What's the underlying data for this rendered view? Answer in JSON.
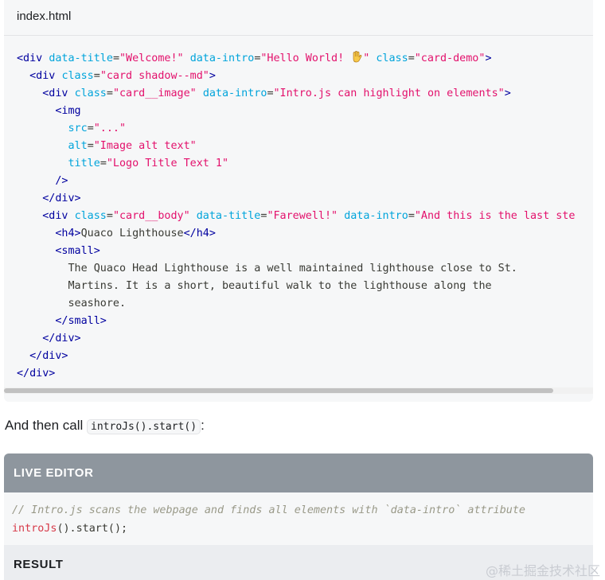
{
  "code_block": {
    "filename": "index.html",
    "lines": [
      [
        {
          "t": "<div ",
          "c": "tag"
        },
        {
          "t": "data-title",
          "c": "attr"
        },
        {
          "t": "=",
          "c": "punc"
        },
        {
          "t": "\"Welcome!\"",
          "c": "str"
        },
        {
          "t": " ",
          "c": "punc"
        },
        {
          "t": "data-intro",
          "c": "attr"
        },
        {
          "t": "=",
          "c": "punc"
        },
        {
          "t": "\"Hello World! ",
          "c": "str"
        },
        {
          "t": "WAVE",
          "c": "emoji"
        },
        {
          "t": "\"",
          "c": "str"
        },
        {
          "t": " ",
          "c": "punc"
        },
        {
          "t": "class",
          "c": "attr"
        },
        {
          "t": "=",
          "c": "punc"
        },
        {
          "t": "\"card-demo\"",
          "c": "str"
        },
        {
          "t": ">",
          "c": "tag"
        }
      ],
      [
        {
          "t": "  <div ",
          "c": "tag"
        },
        {
          "t": "class",
          "c": "attr"
        },
        {
          "t": "=",
          "c": "punc"
        },
        {
          "t": "\"card shadow--md\"",
          "c": "str"
        },
        {
          "t": ">",
          "c": "tag"
        }
      ],
      [
        {
          "t": "    <div ",
          "c": "tag"
        },
        {
          "t": "class",
          "c": "attr"
        },
        {
          "t": "=",
          "c": "punc"
        },
        {
          "t": "\"card__image\"",
          "c": "str"
        },
        {
          "t": " ",
          "c": "punc"
        },
        {
          "t": "data-intro",
          "c": "attr"
        },
        {
          "t": "=",
          "c": "punc"
        },
        {
          "t": "\"Intro.js can highlight on elements\"",
          "c": "str"
        },
        {
          "t": ">",
          "c": "tag"
        }
      ],
      [
        {
          "t": "      <img",
          "c": "tag"
        }
      ],
      [
        {
          "t": "        ",
          "c": "punc"
        },
        {
          "t": "src",
          "c": "attr"
        },
        {
          "t": "=",
          "c": "punc"
        },
        {
          "t": "\"...\"",
          "c": "str"
        }
      ],
      [
        {
          "t": "        ",
          "c": "punc"
        },
        {
          "t": "alt",
          "c": "attr"
        },
        {
          "t": "=",
          "c": "punc"
        },
        {
          "t": "\"Image alt text\"",
          "c": "str"
        }
      ],
      [
        {
          "t": "        ",
          "c": "punc"
        },
        {
          "t": "title",
          "c": "attr"
        },
        {
          "t": "=",
          "c": "punc"
        },
        {
          "t": "\"Logo Title Text 1\"",
          "c": "str"
        }
      ],
      [
        {
          "t": "      />",
          "c": "tag"
        }
      ],
      [
        {
          "t": "    </div>",
          "c": "tag"
        }
      ],
      [
        {
          "t": "    <div ",
          "c": "tag"
        },
        {
          "t": "class",
          "c": "attr"
        },
        {
          "t": "=",
          "c": "punc"
        },
        {
          "t": "\"card__body\"",
          "c": "str"
        },
        {
          "t": " ",
          "c": "punc"
        },
        {
          "t": "data-title",
          "c": "attr"
        },
        {
          "t": "=",
          "c": "punc"
        },
        {
          "t": "\"Farewell!\"",
          "c": "str"
        },
        {
          "t": " ",
          "c": "punc"
        },
        {
          "t": "data-intro",
          "c": "attr"
        },
        {
          "t": "=",
          "c": "punc"
        },
        {
          "t": "\"And this is the last ste",
          "c": "str"
        }
      ],
      [
        {
          "t": "      <h4>",
          "c": "tag"
        },
        {
          "t": "Quaco Lighthouse",
          "c": "punc"
        },
        {
          "t": "</h4>",
          "c": "tag"
        }
      ],
      [
        {
          "t": "      <small>",
          "c": "tag"
        }
      ],
      [
        {
          "t": "        The Quaco Head Lighthouse is a well maintained lighthouse close to St.",
          "c": "punc"
        }
      ],
      [
        {
          "t": "        Martins. It is a short, beautiful walk to the lighthouse along the",
          "c": "punc"
        }
      ],
      [
        {
          "t": "        seashore.",
          "c": "punc"
        }
      ],
      [
        {
          "t": "      </small>",
          "c": "tag"
        }
      ],
      [
        {
          "t": "    </div>",
          "c": "tag"
        }
      ],
      [
        {
          "t": "  </div>",
          "c": "tag"
        }
      ],
      [
        {
          "t": "</div>",
          "c": "tag"
        }
      ]
    ]
  },
  "prose": {
    "before": "And then call ",
    "inline_code": "introJs().start()",
    "after": ":"
  },
  "live_editor": {
    "header": "LIVE EDITOR",
    "comment": "// Intro.js scans the webpage and finds all elements with `data-intro` attribute",
    "call_fn": "introJs",
    "call_rest": "().start();"
  },
  "result": {
    "header": "RESULT"
  },
  "watermark": "@稀土掘金技术社区",
  "colors": {
    "tag": "#00009f",
    "attr": "#00a4db",
    "string": "#e3116c",
    "editor_header_bg": "#8e969e"
  }
}
